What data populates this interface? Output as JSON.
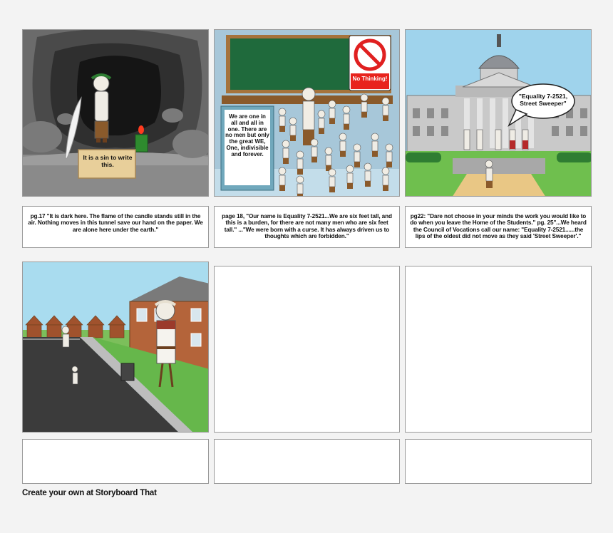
{
  "panels": {
    "p1": {
      "scroll_text": "It is a sin to write this."
    },
    "p2": {
      "board_text": "We are one in all and all in one. There are no men but only the great WE, One, indivisible and forever.",
      "sign_text": "No Thinking!"
    },
    "p3": {
      "speech_text": "\"Equality 7-2521, Street Sweeper\""
    }
  },
  "captions": [
    "pg.17 \"It is dark here.  The flame of the candle stands still in the air. Nothing moves in this tunnel save our hand on the paper. We are alone here under the earth.\"",
    "page 18, \"Our name is Equality 7-2521...We are six feet tall, and this is a burden, for there are not many men who are six feet tall.\" ...\"We were born with a curse.  It has always driven us to thoughts which are forbidden.\"",
    "pg22: \"Dare not choose in your minds the work you would like to do when you leave the Home of the Students.\" pg. 25\"...We heard the Council of Vocations call our name: \"Equality 7-2521......the lips of the oldest did not move as they said 'Street Sweeper'.\""
  ],
  "footer": "Create your own at Storyboard That"
}
